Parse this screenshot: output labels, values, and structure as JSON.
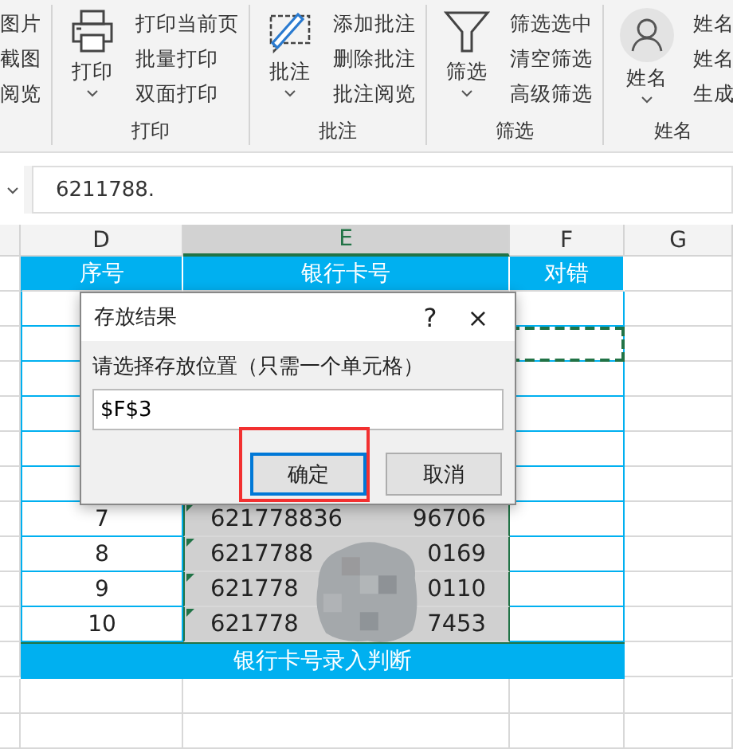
{
  "ribbon": {
    "groups": [
      {
        "kind": "partial",
        "items": [
          "图片",
          "截图",
          "阅览"
        ]
      },
      {
        "kind": "print",
        "big_button": "打印",
        "items": [
          "打印当前页",
          "批量打印",
          "双面打印"
        ],
        "label": "打印"
      },
      {
        "kind": "comment",
        "big_button": "批注",
        "items": [
          "添加批注",
          "删除批注",
          "批注阅览"
        ],
        "label": "批注"
      },
      {
        "kind": "filter",
        "big_button": "筛选",
        "items": [
          "筛选选中",
          "清空筛选",
          "高级筛选"
        ],
        "label": "筛选"
      },
      {
        "kind": "person",
        "big_button": "姓名",
        "items": [
          "姓名",
          "姓名",
          "生成"
        ],
        "label": "姓名"
      }
    ]
  },
  "formula_bar": {
    "value": "6211788."
  },
  "columns": [
    {
      "label": "D",
      "selected": false
    },
    {
      "label": "E",
      "selected": true
    },
    {
      "label": "F",
      "selected": false
    },
    {
      "label": "G",
      "selected": false
    }
  ],
  "table": {
    "headers": [
      "序号",
      "银行卡号",
      "对错"
    ],
    "rows": [
      {
        "number": "7",
        "card_start": "621778836",
        "card_end": "96706"
      },
      {
        "number": "8",
        "card_start": "6217788",
        "card_end": "0169"
      },
      {
        "number": "9",
        "card_start": "621778",
        "card_end": "0110"
      },
      {
        "number": "10",
        "card_start": "621778",
        "card_end": "7453"
      }
    ],
    "footer": "银行卡号录入判断"
  },
  "dialog": {
    "title": "存放结果",
    "help": "?",
    "close": "×",
    "prompt": "请选择存放位置（只需一个单元格）",
    "value": "$F$3",
    "buttons": [
      {
        "label": "确定",
        "default": true
      },
      {
        "label": "取消",
        "default": false
      }
    ]
  }
}
